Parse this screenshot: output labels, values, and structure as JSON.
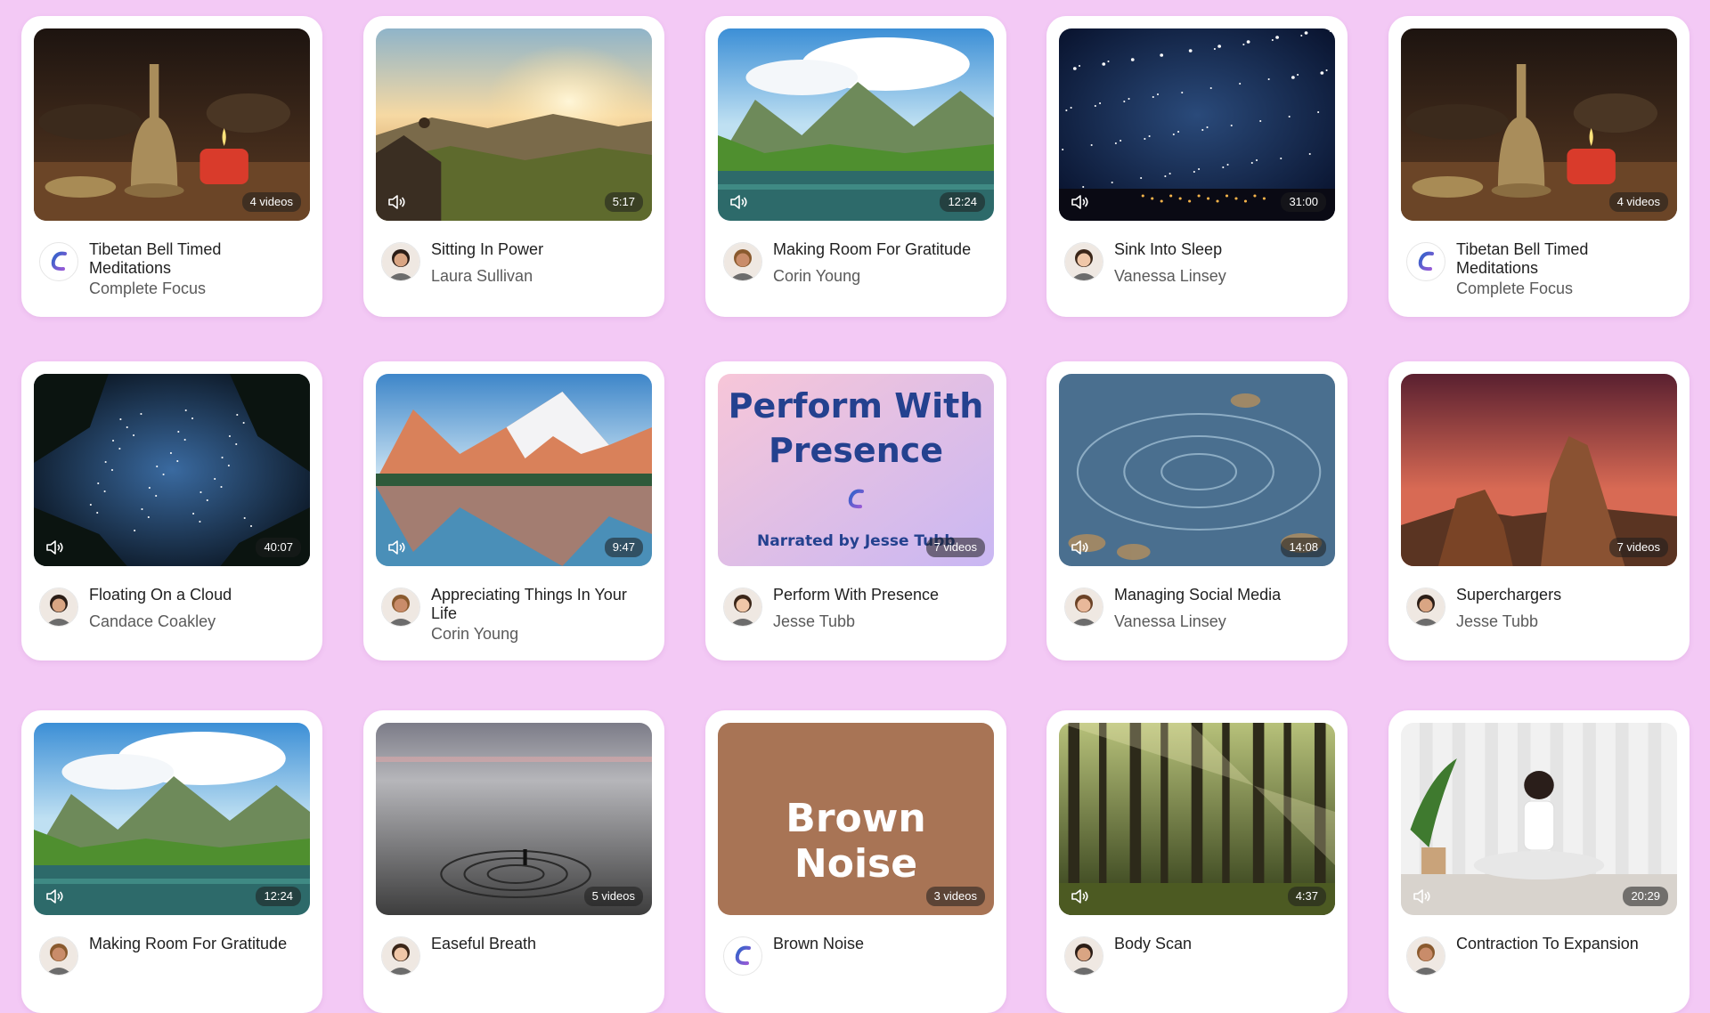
{
  "colors": {
    "background": "#f3c9f5",
    "card": "#ffffff",
    "brand_blue": "#2b63c9",
    "brand_purple": "#9b5ad6",
    "brown_noise": "#a87455"
  },
  "cards": [
    {
      "title": "Tibetan Bell Timed Meditations",
      "author": "Complete Focus",
      "badge": "4 videos",
      "scene": "bell",
      "avatar": "brand-logo"
    },
    {
      "title": "Sitting In Power",
      "author": "Laura Sullivan",
      "badge": "5:17",
      "scene": "sunrise",
      "avatar": "person-avatar",
      "audio": true
    },
    {
      "title": "Making Room For Gratitude",
      "author": "Corin Young",
      "badge": "12:24",
      "scene": "lake",
      "avatar": "person-avatar",
      "audio": true
    },
    {
      "title": "Sink Into Sleep",
      "author": "Vanessa Linsey",
      "badge": "31:00",
      "scene": "stars",
      "avatar": "person-avatar",
      "audio": true
    },
    {
      "title": "Tibetan Bell Timed Meditations",
      "author": "Complete Focus",
      "badge": "4 videos",
      "scene": "bell",
      "avatar": "brand-logo"
    },
    {
      "title": "Floating On a Cloud",
      "author": "Candace Coakley",
      "badge": "40:07",
      "scene": "forest-stars",
      "avatar": "person-avatar",
      "audio": true
    },
    {
      "title": "Appreciating Things In Your Life",
      "author": "Corin Young",
      "badge": "9:47",
      "scene": "mountain-reflect",
      "avatar": "person-avatar",
      "audio": true
    },
    {
      "title": "Perform With Presence",
      "author": "Jesse Tubb",
      "badge": "7 videos",
      "scene": "presence",
      "avatar": "person-avatar"
    },
    {
      "title": "Managing Social Media",
      "author": "Vanessa Linsey",
      "badge": "14:08",
      "scene": "water",
      "avatar": "person-avatar",
      "audio": true
    },
    {
      "title": "Superchargers",
      "author": "Jesse Tubb",
      "badge": "7 videos",
      "scene": "desert",
      "avatar": "person-avatar"
    },
    {
      "title": "Making Room For Gratitude",
      "author": "",
      "badge": "12:24",
      "scene": "lake",
      "avatar": "person-avatar",
      "audio": true
    },
    {
      "title": "Easeful Breath",
      "author": "",
      "badge": "5 videos",
      "scene": "beach",
      "avatar": "person-avatar"
    },
    {
      "title": "Brown Noise",
      "author": "",
      "badge": "3 videos",
      "scene": "brown",
      "avatar": "brand-logo"
    },
    {
      "title": "Body Scan",
      "author": "",
      "badge": "4:37",
      "scene": "woods",
      "avatar": "person-avatar",
      "audio": true
    },
    {
      "title": "Contraction To Expansion",
      "author": "",
      "badge": "20:29",
      "scene": "yoga",
      "avatar": "person-avatar",
      "audio": true
    }
  ],
  "presence_overlay": {
    "line1": "Perform With",
    "line2": "Presence",
    "narrated": "Narrated by Jesse Tubb"
  },
  "brown_overlay": "Brown Noise"
}
